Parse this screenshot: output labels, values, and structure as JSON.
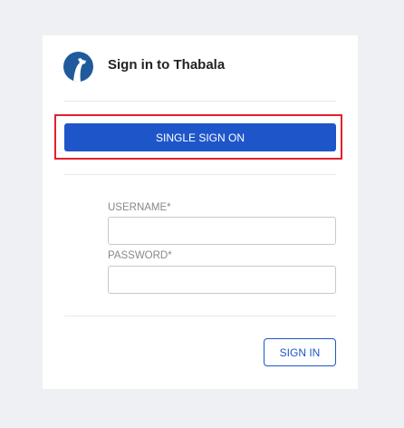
{
  "header": {
    "title": "Sign in to Thabala",
    "logo_icon": "giraffe-logo-icon"
  },
  "sso": {
    "label": "SINGLE SIGN ON",
    "highlight_color": "#e3202b"
  },
  "form": {
    "username_label": "USERNAME*",
    "username_value": "",
    "password_label": "PASSWORD*",
    "password_value": ""
  },
  "actions": {
    "sign_in_label": "SIGN IN"
  },
  "colors": {
    "accent": "#1e56c9",
    "logo": "#1f5a9c"
  }
}
